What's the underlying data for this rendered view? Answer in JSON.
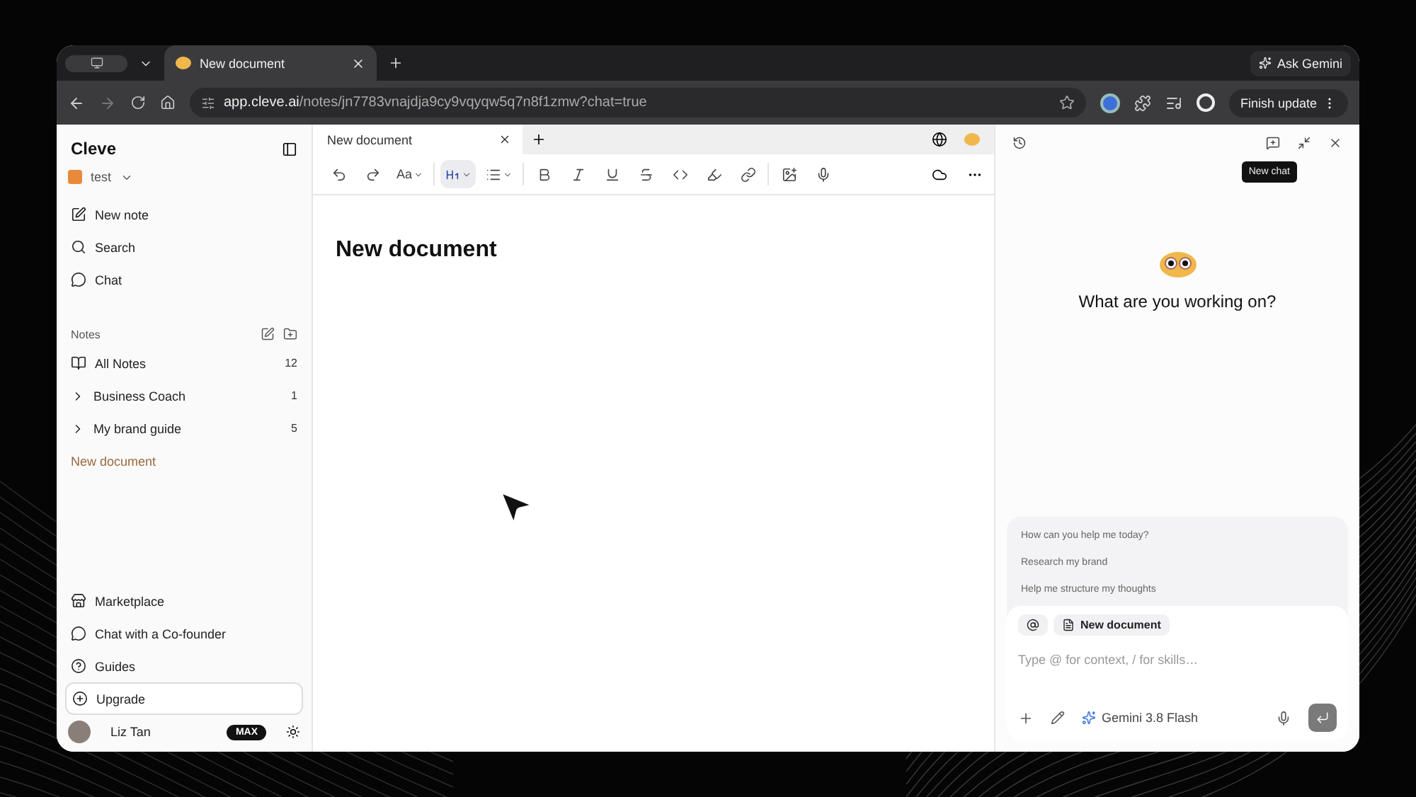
{
  "browser": {
    "tabs": [
      {
        "title": "New document",
        "selected": true
      }
    ],
    "ask_button": "Ask Gemini",
    "url_host": "app.cleve.ai",
    "url_path": "/notes/jn7783vnajdja9cy9vqyqw5q7n8f1zmw?chat=true",
    "update_button": "Finish update"
  },
  "sidebar": {
    "app_name": "Cleve",
    "workspace": "test",
    "nav": [
      {
        "label": "New note",
        "kind": "note"
      },
      {
        "label": "Search",
        "kind": "search"
      },
      {
        "label": "Chat",
        "kind": "chat"
      }
    ],
    "notes_heading": "Notes",
    "notes": [
      {
        "label": "All Notes",
        "count": "12",
        "kind": "all",
        "selected": false
      },
      {
        "label": "Business Coach",
        "count": "1",
        "kind": "folder",
        "selected": false
      },
      {
        "label": "My brand guide",
        "count": "5",
        "kind": "folder",
        "selected": false
      },
      {
        "label": "New document",
        "kind": "doc",
        "selected": true
      }
    ],
    "footer_links": [
      {
        "label": "Marketplace",
        "kind": "store"
      },
      {
        "label": "Chat with a Co-founder",
        "kind": "chat"
      },
      {
        "label": "Guides",
        "kind": "help"
      },
      {
        "label": "Upgrade",
        "kind": "upgrade"
      }
    ],
    "user": {
      "name": "Liz Tan",
      "plan": "MAX"
    }
  },
  "editor": {
    "tabs": [
      {
        "title": "New document",
        "selected": true
      }
    ],
    "toolbar": [
      {
        "kind": "undo",
        "selected": false
      },
      {
        "kind": "redo",
        "selected": false
      },
      {
        "kind": "font",
        "label": "Aa",
        "selected": false
      },
      {
        "kind": "heading",
        "selected": true
      },
      {
        "kind": "list",
        "selected": false
      },
      {
        "kind": "bold",
        "selected": false
      },
      {
        "kind": "italic",
        "selected": false
      },
      {
        "kind": "underline",
        "selected": false
      },
      {
        "kind": "strike",
        "selected": false
      },
      {
        "kind": "code",
        "selected": false
      },
      {
        "kind": "highlight",
        "selected": false
      },
      {
        "kind": "link",
        "selected": false
      },
      {
        "kind": "image",
        "selected": false
      },
      {
        "kind": "mic",
        "selected": false
      }
    ],
    "title": "New document"
  },
  "chat": {
    "tooltip": "New chat",
    "prompt": "What are you working on?",
    "suggestions": [
      "How can you help me today?",
      "Research my brand",
      "Help me structure my thoughts"
    ],
    "context_chip": "New document",
    "placeholder": "Type @ for context, / for skills…",
    "model": "Gemini 3.8 Flash"
  }
}
